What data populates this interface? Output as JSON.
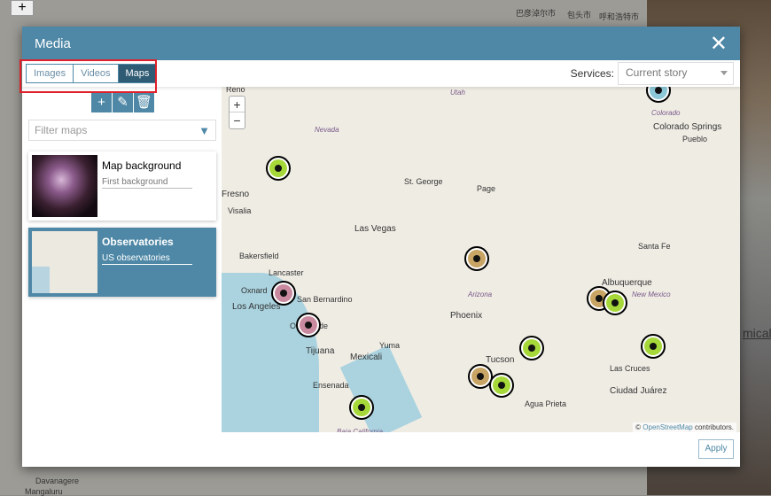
{
  "background": {
    "zoom_in": "+",
    "labels": [
      "巴彦淖尔市",
      "包头市",
      "呼和浩特市",
      "Davanagere",
      "Mangaluru",
      "mical"
    ]
  },
  "modal": {
    "title": "Media",
    "close": "✕",
    "tabs": [
      {
        "label": "Images",
        "active": false
      },
      {
        "label": "Videos",
        "active": false
      },
      {
        "label": "Maps",
        "active": true
      }
    ],
    "services_label": "Services:",
    "services_value": "Current story",
    "actions": {
      "add": "+",
      "edit": "✎",
      "delete": "🗑"
    },
    "filter_placeholder": "Filter maps",
    "maps": [
      {
        "title": "Map background",
        "subtitle": "First background",
        "selected": false
      },
      {
        "title": "Observatories",
        "subtitle": "US observatories",
        "selected": true
      }
    ],
    "apply": "Apply"
  },
  "map": {
    "zoom_in": "+",
    "zoom_out": "−",
    "labels": [
      "Reno",
      "Utah",
      "Nevada",
      "St. George",
      "Page",
      "Fresno",
      "Visalia",
      "Las Vegas",
      "Bakersfield",
      "Lancaster",
      "Oxnard",
      "Los Angeles",
      "San Bernardino",
      "Oceanside",
      "Tijuana",
      "Mexicali",
      "Yuma",
      "Ensenada",
      "Arizona",
      "Phoenix",
      "Tucson",
      "Agua Prieta",
      "Albuquerque",
      "Santa Fe",
      "New Mexico",
      "Las Cruces",
      "Ciudad Juárez",
      "Colorado",
      "Colorado Springs",
      "Pueblo",
      "Baja California"
    ],
    "attribution_prefix": "© ",
    "attribution_link": "OpenStreetMap",
    "attribution_suffix": " contributors.",
    "colors": {
      "green": "#a6d83a",
      "tan": "#c9a565",
      "pink": "#c98aa0",
      "blue": "#8cc8d8"
    }
  }
}
